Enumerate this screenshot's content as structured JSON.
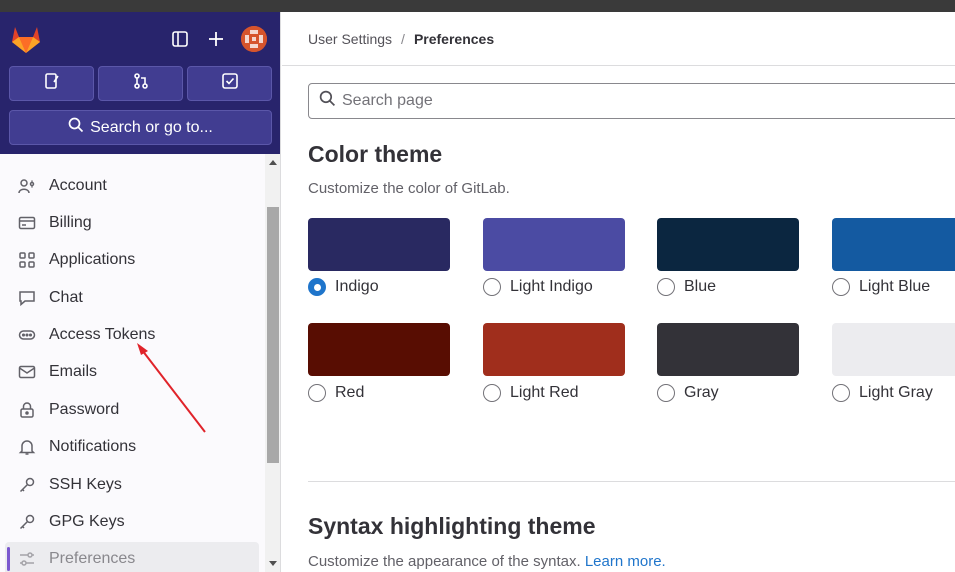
{
  "header": {
    "search_label": "Search or go to...",
    "quick_actions": [
      "issues-icon",
      "merge-requests-icon",
      "todo-icon"
    ]
  },
  "sidebar": {
    "items": [
      {
        "label": "Account",
        "icon": "account-icon"
      },
      {
        "label": "Billing",
        "icon": "billing-icon"
      },
      {
        "label": "Applications",
        "icon": "applications-icon"
      },
      {
        "label": "Chat",
        "icon": "chat-icon"
      },
      {
        "label": "Access Tokens",
        "icon": "token-icon"
      },
      {
        "label": "Emails",
        "icon": "mail-icon"
      },
      {
        "label": "Password",
        "icon": "lock-icon"
      },
      {
        "label": "Notifications",
        "icon": "bell-icon"
      },
      {
        "label": "SSH Keys",
        "icon": "key-icon"
      },
      {
        "label": "GPG Keys",
        "icon": "key-icon"
      },
      {
        "label": "Preferences",
        "icon": "preferences-icon",
        "active": true
      }
    ]
  },
  "breadcrumb": {
    "parent": "User Settings",
    "separator": "/",
    "current": "Preferences"
  },
  "search": {
    "placeholder": "Search page"
  },
  "color_theme": {
    "title": "Color theme",
    "description": "Customize the color of GitLab.",
    "selected": "Indigo",
    "options": [
      {
        "label": "Indigo",
        "color": "#292961"
      },
      {
        "label": "Light Indigo",
        "color": "#4b4ba3"
      },
      {
        "label": "Blue",
        "color": "#0b2640"
      },
      {
        "label": "Light Blue",
        "color": "#145aa1"
      },
      {
        "label": "Red",
        "color": "#580d02"
      },
      {
        "label": "Light Red",
        "color": "#a02e1c"
      },
      {
        "label": "Gray",
        "color": "#333238"
      },
      {
        "label": "Light Gray",
        "color": "#ececef"
      }
    ]
  },
  "syntax_theme": {
    "title": "Syntax highlighting theme",
    "description": "Customize the appearance of the syntax.",
    "link": "Learn more."
  },
  "colors": {
    "brand": "#28246c",
    "accent": "#1f75cb",
    "annotation_arrow": "#e0232a"
  }
}
